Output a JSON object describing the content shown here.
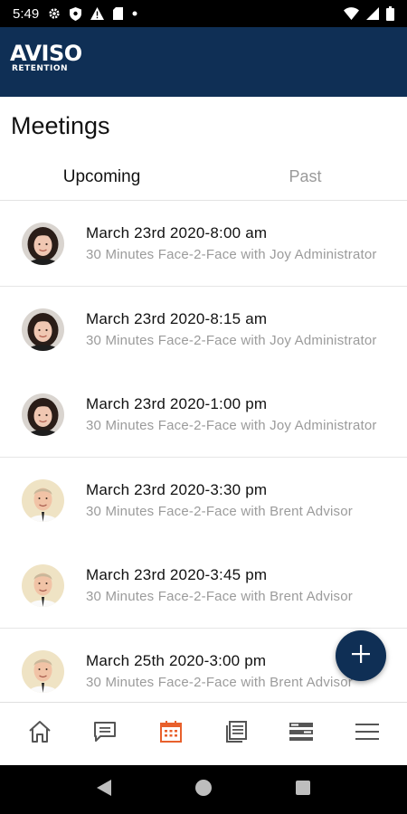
{
  "status_bar": {
    "time": "5:49",
    "icons": [
      "gear-icon",
      "shield-icon",
      "warning-icon",
      "sim-card-icon",
      "dot-icon",
      "wifi-icon",
      "cell-signal-icon",
      "battery-icon"
    ]
  },
  "header": {
    "logo_main": "AVISO",
    "logo_sub": "RETENTION",
    "background": "#0f2f55"
  },
  "page": {
    "title": "Meetings"
  },
  "tabs": [
    {
      "label": "Upcoming",
      "active": true
    },
    {
      "label": "Past",
      "active": false
    }
  ],
  "meetings": [
    {
      "date": "March 23rd 2020-8:00 am",
      "description": "30 Minutes Face-2-Face with Joy Administrator",
      "avatar": "woman-avatar"
    },
    {
      "date": "March 23rd 2020-8:15 am",
      "description": "30 Minutes Face-2-Face with Joy Administrator",
      "avatar": "woman-avatar"
    },
    {
      "date": "March 23rd 2020-1:00 pm",
      "description": "30 Minutes Face-2-Face with Joy Administrator",
      "avatar": "woman-avatar"
    },
    {
      "date": "March 23rd 2020-3:30 pm",
      "description": "30 Minutes Face-2-Face with Brent Advisor",
      "avatar": "man-avatar"
    },
    {
      "date": "March 23rd 2020-3:45 pm",
      "description": "30 Minutes Face-2-Face with Brent Advisor",
      "avatar": "man-avatar"
    },
    {
      "date": "March 25th 2020-3:00 pm",
      "description": "30 Minutes Face-2-Face with Brent Advisor",
      "avatar": "man-avatar"
    }
  ],
  "fab": {
    "icon": "plus-icon"
  },
  "bottom_nav": [
    {
      "icon": "home-icon",
      "active": false
    },
    {
      "icon": "chat-icon",
      "active": false
    },
    {
      "icon": "calendar-icon",
      "active": true
    },
    {
      "icon": "documents-icon",
      "active": false
    },
    {
      "icon": "list-view-icon",
      "active": false
    },
    {
      "icon": "menu-icon",
      "active": false
    }
  ],
  "colors": {
    "accent": "#e8602c",
    "primary": "#0f2f55",
    "muted_text": "#9b9b9b"
  }
}
